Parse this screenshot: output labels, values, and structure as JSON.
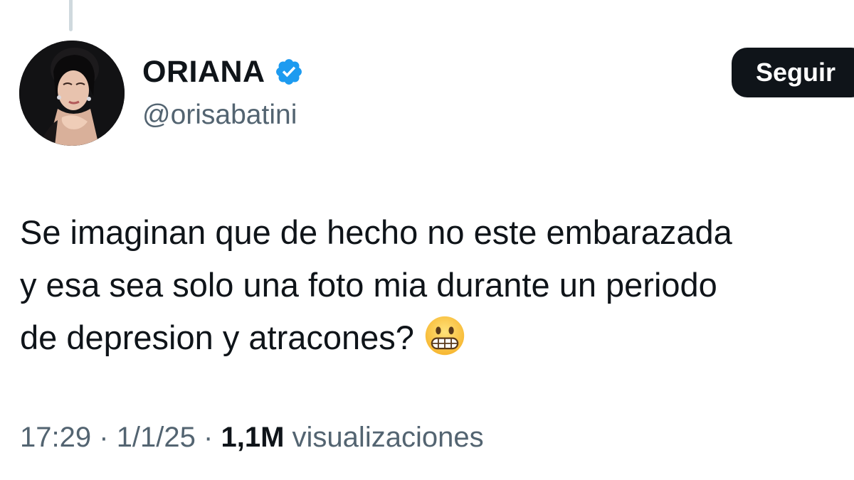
{
  "author": {
    "display_name": "ORIANA",
    "handle": "@orisabatini",
    "verified": true,
    "verified_icon": "verified-badge-icon",
    "verified_color": "#1d9bf0"
  },
  "follow_button": {
    "label": "Seguir"
  },
  "tweet": {
    "lines": [
      "Se imaginan que de hecho no este embarazada",
      "y esa sea solo una foto mia durante un periodo",
      "de depresion y atracones?"
    ],
    "emoji": "grimacing-face-emoji"
  },
  "meta": {
    "time": "17:29",
    "separator": "·",
    "date": "1/1/25",
    "views_count": "1,1M",
    "views_label": "visualizaciones"
  },
  "colors": {
    "text": "#0f1419",
    "secondary": "#536471",
    "button_bg": "#0f1419",
    "thread_line": "#cfd9de"
  }
}
